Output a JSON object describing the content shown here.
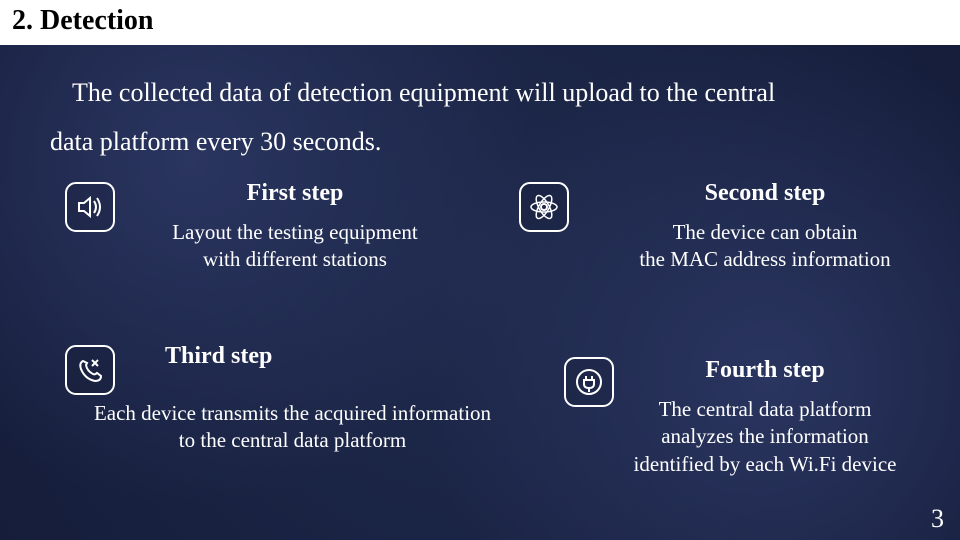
{
  "title": "2.  Detection",
  "subtitle_line1": "The collected data of detection equipment will upload to the central",
  "subtitle_line2": "data platform every 30 seconds.",
  "steps": {
    "first": {
      "title": "First step",
      "desc_l1": "Layout the testing equipment",
      "desc_l2": "with different stations"
    },
    "second": {
      "title": "Second step",
      "desc_l1": "The  device can obtain",
      "desc_l2": "the MAC address information"
    },
    "third": {
      "title": "Third step",
      "desc_l1": "Each device transmits  the acquired information",
      "desc_l2": "to the central data platform"
    },
    "fourth": {
      "title": "Fourth step",
      "desc_l1": "The central data platform",
      "desc_l2": "analyzes the information",
      "desc_l3": "identified by each Wi.Fi device"
    }
  },
  "page_number": "3"
}
